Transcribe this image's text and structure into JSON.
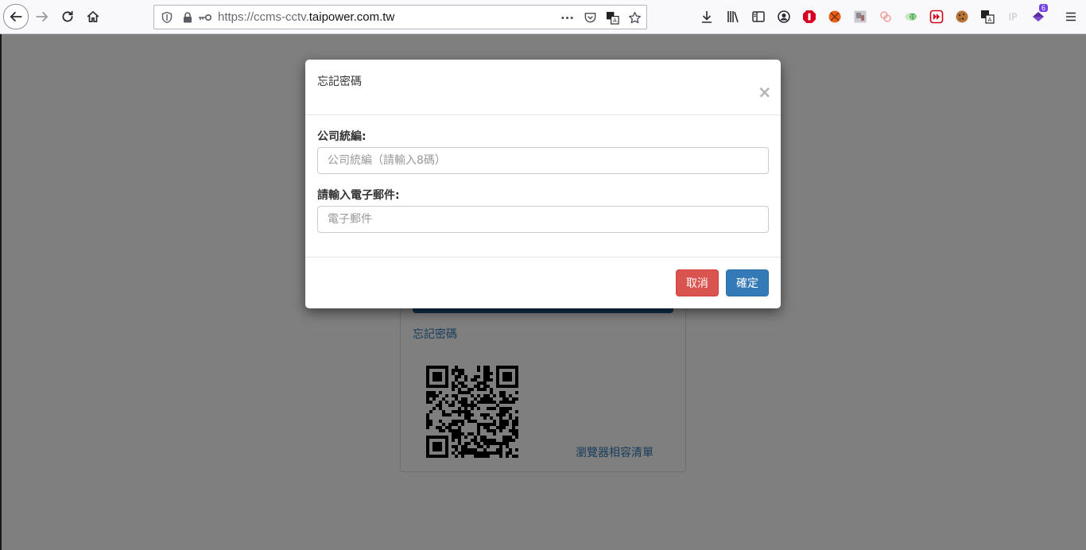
{
  "browser": {
    "url_prefix": "https://ccms-cctv.",
    "url_domain": "taipower.com.tw",
    "extension_badge": "6"
  },
  "page": {
    "forgot_link": "忘記密碼",
    "compat_link": "瀏覽器相容清單"
  },
  "modal": {
    "title": "忘記密碼",
    "close": "×",
    "company_label": "公司統編:",
    "company_placeholder": "公司統編（請輸入8碼）",
    "email_label": "請輸入電子郵件:",
    "email_placeholder": "電子郵件",
    "cancel_label": "取消",
    "confirm_label": "確定"
  },
  "colors": {
    "cancel": "#d9534f",
    "confirm": "#337ab7",
    "link": "#337ab7"
  }
}
